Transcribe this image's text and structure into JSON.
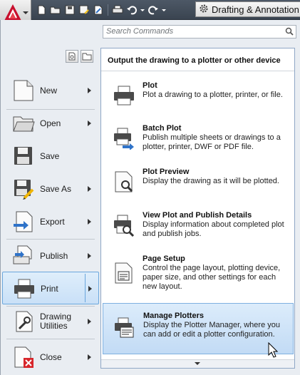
{
  "titlebar": {
    "app_icon": "autocad-logo-icon",
    "quick_access": [
      "new-icon",
      "open-icon",
      "save-icon",
      "save-as-icon",
      "publish-icon",
      "plot-icon",
      "undo-icon",
      "redo-icon"
    ],
    "workspace_label": "Drafting & Annotation",
    "workspace_icon": "gear-icon"
  },
  "search": {
    "placeholder": "Search Commands",
    "icon": "search-icon"
  },
  "menu": {
    "items": [
      {
        "label": "New",
        "icon": "new-document-icon",
        "submenu": true
      },
      {
        "label": "Open",
        "icon": "open-folder-icon",
        "submenu": true
      },
      {
        "label": "Save",
        "icon": "save-icon",
        "submenu": false
      },
      {
        "label": "Save As",
        "icon": "save-as-icon",
        "submenu": true
      },
      {
        "label": "Export",
        "icon": "export-icon",
        "submenu": true
      },
      {
        "label": "Publish",
        "icon": "publish-icon",
        "submenu": true
      },
      {
        "label": "Print",
        "icon": "printer-icon",
        "submenu": true,
        "selected": true
      },
      {
        "label": "Drawing Utilities",
        "icon": "wrench-icon",
        "submenu": true
      },
      {
        "label": "Close",
        "icon": "close-document-icon",
        "submenu": true
      }
    ]
  },
  "print_panel": {
    "header": "Output the drawing to a plotter or other device",
    "items": [
      {
        "title": "Plot",
        "desc": "Plot a drawing to a plotter, printer, or file.",
        "icon": "plot-icon"
      },
      {
        "title": "Batch Plot",
        "desc": "Publish multiple sheets or drawings to a plotter, printer, DWF or PDF file.",
        "icon": "batch-plot-icon"
      },
      {
        "title": "Plot Preview",
        "desc": "Display the drawing as it will be plotted.",
        "icon": "plot-preview-icon"
      },
      {
        "title": "View Plot and Publish Details",
        "desc": "Display information about completed plot and publish jobs.",
        "icon": "plot-details-icon"
      },
      {
        "title": "Page Setup",
        "desc": "Control the page layout, plotting device, paper size, and other settings for each new layout.",
        "icon": "page-setup-icon"
      },
      {
        "title": "Manage Plotters",
        "desc": "Display the Plotter Manager, where you can add or edit a plotter configuration.",
        "icon": "manage-plotters-icon",
        "highlighted": true
      }
    ]
  },
  "colors": {
    "accent": "#c2dbf5",
    "app_red": "#c8102e"
  }
}
